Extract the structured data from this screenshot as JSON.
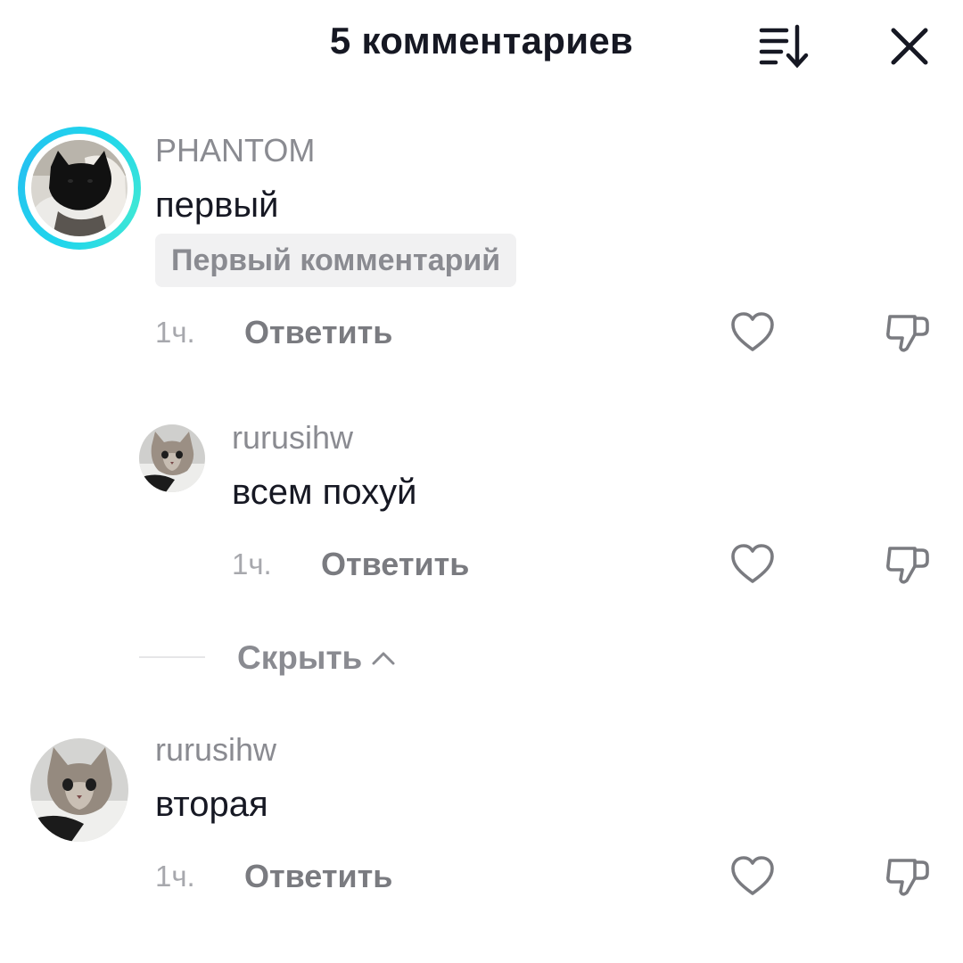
{
  "header": {
    "title": "5 комментариев",
    "sort_icon": "sort-icon",
    "close_icon": "close-icon"
  },
  "comments": [
    {
      "username": "PHANTOM",
      "text": "первый",
      "badge": "Первый комментарий",
      "time": "1ч.",
      "reply_label": "Ответить",
      "avatar_ring_color": "#20d5ec"
    },
    {
      "username": "rurusihw",
      "text": "всем похуй",
      "time": "1ч.",
      "reply_label": "Ответить",
      "is_reply": true
    },
    {
      "username": "rurusihw",
      "text": "вторая",
      "time": "1ч.",
      "reply_label": "Ответить"
    }
  ],
  "thread": {
    "hide_label": "Скрыть",
    "hide_icon": "chevron-up-icon"
  },
  "icons": {
    "like": "heart-icon",
    "dislike": "thumbs-down-icon"
  },
  "colors": {
    "text": "#161823",
    "secondary": "#8a8b91",
    "ring": "#20d5ec"
  }
}
